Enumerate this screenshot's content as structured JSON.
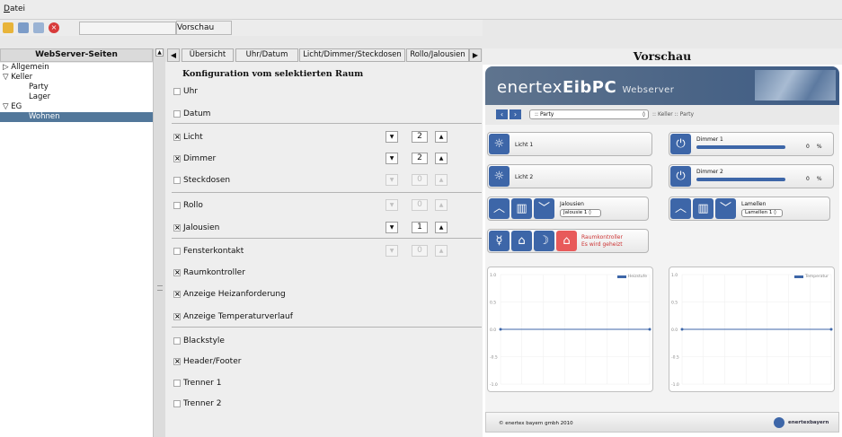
{
  "menubar": {
    "datei": "Datei"
  },
  "toolbar": {
    "vorschau_button": "Vorschau"
  },
  "left": {
    "header": "WebServer-Seiten",
    "tree": [
      {
        "label": "Allgemein",
        "marker": "▷",
        "level": 0
      },
      {
        "label": "Keller",
        "marker": "▽",
        "level": 0
      },
      {
        "label": "Party",
        "marker": "",
        "level": 1
      },
      {
        "label": "Lager",
        "marker": "",
        "level": 1
      },
      {
        "label": "EG",
        "marker": "▽",
        "level": 0
      },
      {
        "label": "Wohnen",
        "marker": "",
        "level": 1,
        "selected": true
      }
    ]
  },
  "tabs": [
    "Übersicht",
    "Uhr/Datum",
    "Licht/Dimmer/Steckdosen",
    "Rollo/Jalousien"
  ],
  "config": {
    "title": "Konfiguration vom selektierten Raum",
    "rows": [
      {
        "label": "Uhr",
        "checked": false
      },
      {
        "label": "Datum",
        "checked": false
      },
      {
        "label": "Licht",
        "checked": true,
        "count": "2",
        "enabled": true
      },
      {
        "label": "Dimmer",
        "checked": true,
        "count": "2",
        "enabled": true
      },
      {
        "label": "Steckdosen",
        "checked": false,
        "count": "0",
        "enabled": false
      },
      {
        "label": "Rollo",
        "checked": false,
        "count": "0",
        "enabled": false
      },
      {
        "label": "Jalousien",
        "checked": true,
        "count": "1",
        "enabled": true
      },
      {
        "label": "Fensterkontakt",
        "checked": false,
        "count": "0",
        "enabled": false
      },
      {
        "label": "Raumkontroller",
        "checked": true
      },
      {
        "label": "Anzeige Heizanforderung",
        "checked": true
      },
      {
        "label": "Anzeige Temperaturverlauf",
        "checked": true
      },
      {
        "label": "Blackstyle",
        "checked": false
      },
      {
        "label": "Header/Footer",
        "checked": true
      },
      {
        "label": "Trenner 1",
        "checked": false
      },
      {
        "label": "Trenner 2",
        "checked": false
      }
    ]
  },
  "preview": {
    "title": "Vorschau",
    "logo_thin": "enertex",
    "logo_bold": "EibPC",
    "logo_sub": "Webserver",
    "room_select": ":: Party",
    "path": ":: Keller :: Party",
    "licht1": "Licht 1",
    "licht2": "Licht 2",
    "dimmer1": "Dimmer 1",
    "dimmer2": "Dimmer 2",
    "dimmer1_value": "0",
    "dimmer2_value": "0",
    "dimmer_unit": "%",
    "dimmer1_fill": 0.9,
    "dimmer2_fill": 0.9,
    "jalousien_label": "Jalousien",
    "jalousie_select": "Jalousie 1 ◊",
    "lamellen_label": "Lamellen",
    "lamellen_select": "Lamellen 1 ◊",
    "raumkontroller": "Raumkontroller",
    "raumkontroller_status": "Es wird geheizt",
    "chart1_legend": "Heizstufe",
    "chart2_legend": "Temperatur",
    "footer_text": "© enertex bayern gmbh 2010",
    "footer_brand": "enertexbayern"
  },
  "chart_data": [
    {
      "type": "line",
      "series": [
        {
          "name": "Heizstufe",
          "y": 0
        }
      ],
      "ylim": [
        -1.0,
        1.0
      ],
      "yticks": [
        "1.0",
        "0.5",
        "0.0",
        "-0.5",
        "-1.0"
      ]
    },
    {
      "type": "line",
      "series": [
        {
          "name": "Temperatur",
          "y": 0
        }
      ],
      "ylim": [
        -1.0,
        1.0
      ],
      "yticks": [
        "1.0",
        "0.5",
        "0.0",
        "-0.5",
        "-1.0"
      ]
    }
  ],
  "colors": {
    "selected": "#52779a",
    "accent": "#3d66a8",
    "raum_icon": "#e85a5a"
  }
}
